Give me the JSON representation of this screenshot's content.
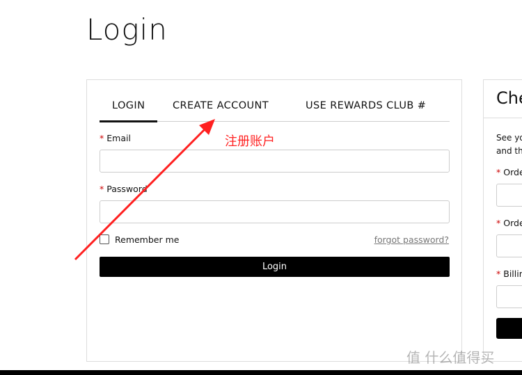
{
  "page": {
    "title": "Login"
  },
  "login_card": {
    "tabs": [
      {
        "label": "LOGIN",
        "active": true
      },
      {
        "label": "CREATE ACCOUNT"
      },
      {
        "label": "USE REWARDS CLUB #"
      }
    ],
    "email_label": "Email",
    "password_label": "Password",
    "required_mark": "*",
    "remember_label": "Remember me",
    "forgot_label": "forgot password?",
    "login_button": "Login"
  },
  "check_card": {
    "title": "Che",
    "desc_line1": "See yo",
    "desc_line2": "and th",
    "fields": [
      "Orde",
      "Orde",
      "Billin"
    ]
  },
  "annotation": {
    "text": "注册账户",
    "color": "#ff2222"
  },
  "watermark": "值 什么值得买"
}
